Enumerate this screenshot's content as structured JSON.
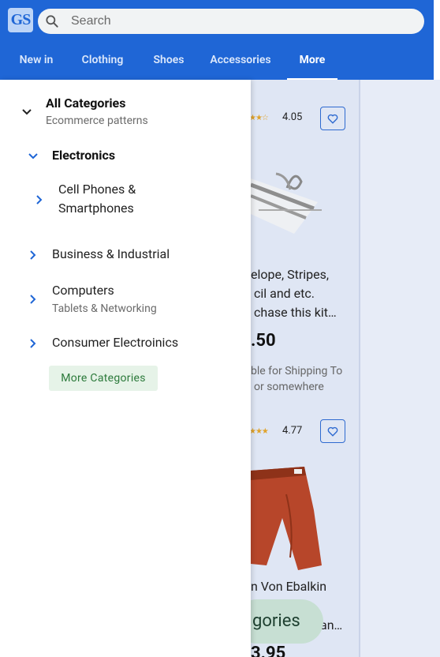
{
  "app": {
    "logo_text": "GS"
  },
  "search": {
    "placeholder": "Search"
  },
  "nav": {
    "items": [
      {
        "label": "New in"
      },
      {
        "label": "Clothing"
      },
      {
        "label": "Shoes"
      },
      {
        "label": "Accessories"
      },
      {
        "label": "More",
        "active": true
      }
    ]
  },
  "drawer": {
    "root": {
      "title": "All Categories",
      "subtitle": "Ecommerce patterns"
    },
    "electronics": {
      "label": "Electronics"
    },
    "cell_phones": {
      "line1": "Cell Phones &",
      "line2": "Smartphones"
    },
    "business": {
      "label": "Business & Industrial"
    },
    "computers": {
      "label": "Computers",
      "subtitle": "Tablets & Networking"
    },
    "consumer": {
      "label": "Consumer Electroinics"
    },
    "more_button": "More Categories"
  },
  "background": {
    "product1": {
      "rating": "4.05",
      "text_line1": "elope, Stripes,",
      "text_line2": "cil and etc.",
      "text_line3": "chase this kit…",
      "price": ".50",
      "ship_line1": "ble for Shipping To",
      "ship_line2": "or somewhere"
    },
    "product2": {
      "rating": "4.77",
      "text_line1": "n Von Ebalkin",
      "text_line2": "an…",
      "price": "3.95"
    },
    "pill_label": "gories"
  },
  "colors": {
    "header": "#1f66d6",
    "accent_green": "#2c7a3b",
    "chevron_blue": "#1f66d6"
  }
}
